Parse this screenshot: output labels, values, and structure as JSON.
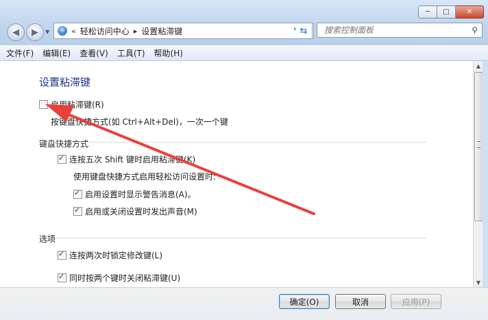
{
  "window": {
    "minimize_glyph": "─",
    "maximize_glyph": "□",
    "close_glyph": "✕"
  },
  "nav": {
    "back_glyph": "◀",
    "forward_glyph": "▶"
  },
  "address": {
    "root_glyph": "«",
    "crumb_1": "轻松访问中心",
    "sep_glyph": "▸",
    "crumb_2": "设置粘滞键"
  },
  "search": {
    "placeholder": "搜索控制面板"
  },
  "menu": {
    "file": "文件(F)",
    "edit": "编辑(E)",
    "view": "查看(V)",
    "tools": "工具(T)",
    "help": "帮助(H)"
  },
  "page": {
    "title": "设置粘滞键",
    "enable_label": "启用粘滞键(R)",
    "enable_desc": "按键盘快捷方式(如 Ctrl+Alt+Del)，一次一个键",
    "shortcut_section": "键盘快捷方式",
    "shift5_label": "连按五次 Shift 键时启用粘滞键(K)",
    "shortcut_desc": "使用键盘快捷方式启用轻松访问设置时:",
    "warn_label": "启用设置时显示警告消息(A)。",
    "sound_label": "启用或关闭设置时发出声音(M)",
    "options_section": "选项",
    "lock_label": "连按两次时锁定修改键(L)",
    "twokeys_label": "同时按两个键时关闭粘滞键(U)"
  },
  "state": {
    "enable_checked": false,
    "shift5_checked": true,
    "warn_checked": true,
    "sound_checked": true,
    "lock_checked": true,
    "twokeys_checked": true
  },
  "buttons": {
    "ok": "确定(O)",
    "cancel": "取消",
    "apply": "应用(P)"
  },
  "colors": {
    "title": "#1e3287",
    "annotation_arrow": "#e8413c"
  }
}
